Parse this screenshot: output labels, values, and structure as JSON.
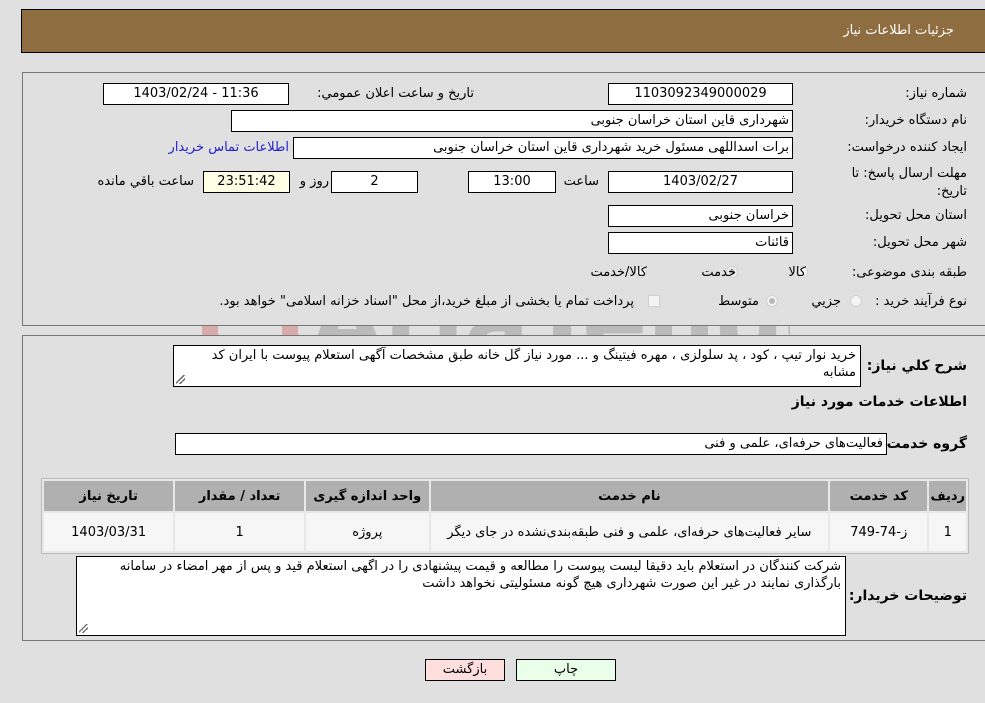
{
  "header": {
    "title": "جزئیات اطلاعات نیاز"
  },
  "details": {
    "need_number_label": "شماره نیاز:",
    "need_number": "1103092349000029",
    "announce_label": "تاريخ و ساعت اعلان عمومي:",
    "announce_value": "1403/02/24 - 11:36",
    "buyer_org_label": "نام دستگاه خريدار:",
    "buyer_org": "شهرداری قاین استان خراسان جنوبی",
    "creator_label": "ايجاد کننده درخواست:",
    "creator": "برات اسداللهی مسئول خرید شهرداری قاین استان خراسان جنوبی",
    "contact_link": "اطلاعات تماس خريدار",
    "deadline_label": "مهلت ارسال پاسخ: تا تاریخ:",
    "deadline_date": "1403/02/27",
    "time_label": "ساعت",
    "deadline_time": "13:00",
    "days_value": "2",
    "days_label": "روز و",
    "remaining_time": "23:51:42",
    "remaining_label": "ساعت باقي مانده",
    "province_label": "استان محل تحويل:",
    "province": "خراسان جنوبی",
    "city_label": "شهر محل تحويل:",
    "city": "قائنات",
    "category_label": "طبقه بندی موضوعی:",
    "category_options": [
      {
        "label": "کالا",
        "selected": false
      },
      {
        "label": "خدمت",
        "selected": true
      },
      {
        "label": "کالا/خدمت",
        "selected": false
      }
    ],
    "process_label": "نوع فرآيند خريد :",
    "process_options": [
      {
        "label": "جزيي",
        "selected": false
      },
      {
        "label": "متوسط",
        "selected": true
      }
    ],
    "treasury_checkbox_label": "پرداخت تمام يا بخشی از مبلغ خريد،از محل \"اسناد خزانه اسلامی\" خواهد بود.",
    "treasury_checked": false
  },
  "need": {
    "summary_label": "شرح کلي نياز:",
    "summary": "خرید نوار تیپ ، کود ، پد سلولزی ، مهره فیتینگ و ... مورد نیاز گل خانه طبق مشخصات آگهی استعلام پیوست با ایران کد مشابه",
    "services_heading": "اطلاعات خدمات مورد نياز",
    "service_group_label": "گروه خدمت:",
    "service_group": "فعالیت‌های حرفه‌ای، علمی و فنی",
    "table": {
      "headers": [
        "رديف",
        "کد خدمت",
        "نام خدمت",
        "واحد اندازه گيری",
        "تعداد / مقدار",
        "تاريخ نياز"
      ],
      "rows": [
        [
          "1",
          "ز-74-749",
          "سایر فعالیت‌های حرفه‌ای، علمی و فنی طبقه‌بندی‌نشده در جای دیگر",
          "پروژه",
          "1",
          "1403/03/31"
        ]
      ]
    },
    "buyer_notes_label": "توضيحات خريدار:",
    "buyer_notes": "شرکت کنندگان در استعلام باید دقیقا لیست پیوست را مطالعه و قیمت پیشنهادی را در اگهی استعلام قید و پس از مهر امضاء در سامانه بارگذاری نمایند در غیر این صورت شهرداری هیچ گونه مسئولیتی نخواهد داشت"
  },
  "buttons": {
    "print": "چاپ",
    "back": "بازگشت"
  },
  "watermark": {
    "text": "AriaTender.neT"
  },
  "colors": {
    "header_bg": "#8e6d41",
    "print_bg": "#eaffea",
    "back_bg": "#ffdede",
    "link": "#2222cc"
  }
}
